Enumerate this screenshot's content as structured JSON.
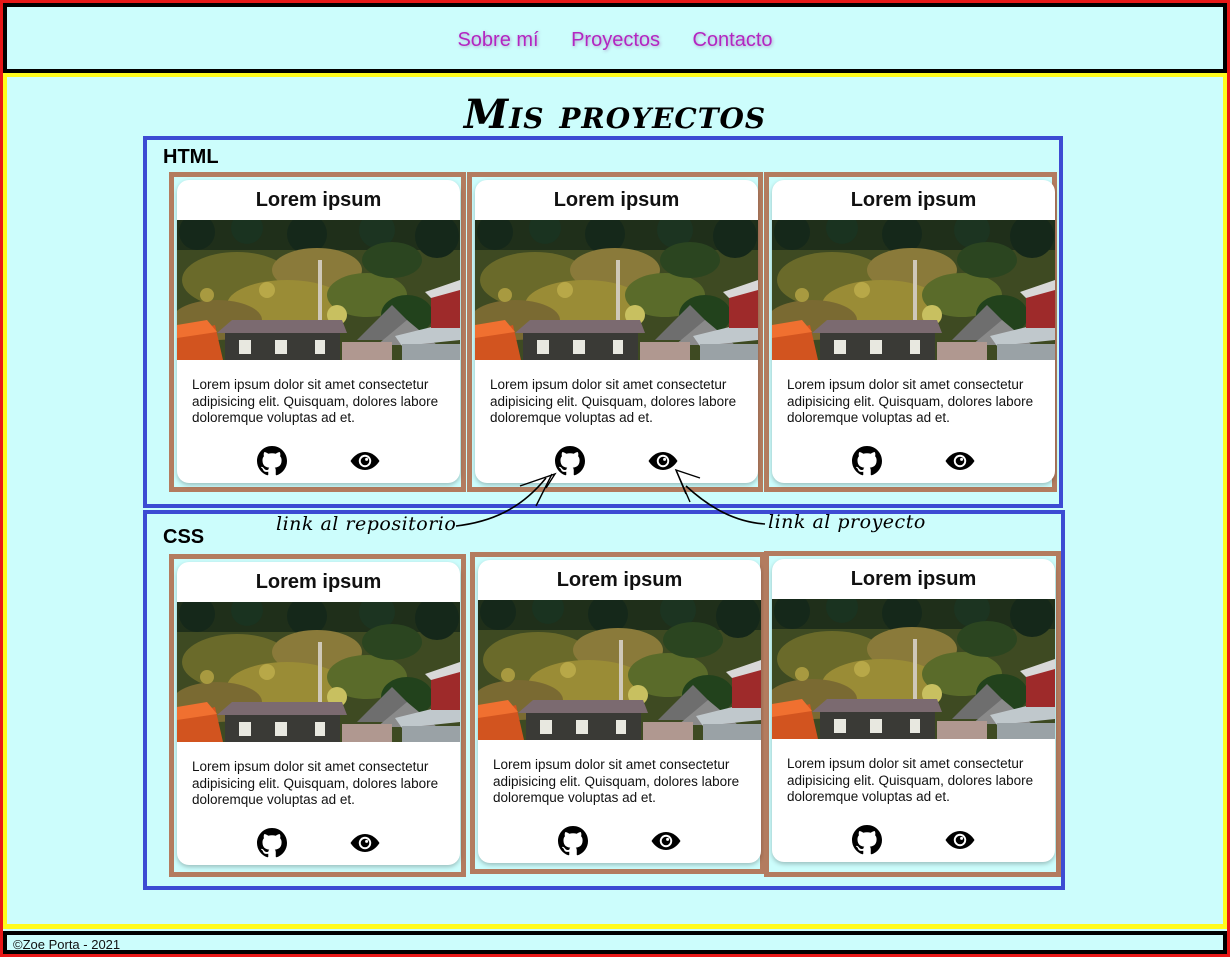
{
  "nav": {
    "items": [
      {
        "label": "Sobre mí"
      },
      {
        "label": "Proyectos"
      },
      {
        "label": "Contacto"
      }
    ]
  },
  "main": {
    "title": "Mis proyectos",
    "groups": [
      {
        "label": "HTML",
        "cards": [
          {
            "title": "Lorem ipsum",
            "text": "Lorem ipsum dolor sit amet consectetur adipisicing elit. Quisquam, dolores labore doloremque voluptas ad et.",
            "repo_icon": "github-icon",
            "project_icon": "eye-icon"
          },
          {
            "title": "Lorem ipsum",
            "text": "Lorem ipsum dolor sit amet consectetur adipisicing elit. Quisquam, dolores labore doloremque voluptas ad et.",
            "repo_icon": "github-icon",
            "project_icon": "eye-icon"
          },
          {
            "title": "Lorem ipsum",
            "text": "Lorem ipsum dolor sit amet consectetur adipisicing elit. Quisquam, dolores labore doloremque voluptas ad et.",
            "repo_icon": "github-icon",
            "project_icon": "eye-icon"
          }
        ]
      },
      {
        "label": "CSS",
        "cards": [
          {
            "title": "Lorem ipsum",
            "text": "Lorem ipsum dolor sit amet consectetur adipisicing elit. Quisquam, dolores labore doloremque voluptas ad et.",
            "repo_icon": "github-icon",
            "project_icon": "eye-icon"
          },
          {
            "title": "Lorem ipsum",
            "text": "Lorem ipsum dolor sit amet consectetur adipisicing elit. Quisquam, dolores labore doloremque voluptas ad et.",
            "repo_icon": "github-icon",
            "project_icon": "eye-icon"
          },
          {
            "title": "Lorem ipsum",
            "text": "Lorem ipsum dolor sit amet consectetur adipisicing elit. Quisquam, dolores labore doloremque voluptas ad et.",
            "repo_icon": "github-icon",
            "project_icon": "eye-icon"
          }
        ]
      }
    ]
  },
  "annotations": {
    "repo": "link al repositorio",
    "project": "link al proyecto"
  },
  "footer": {
    "text": "©Zoe Porta - 2021"
  },
  "colors": {
    "background": "#ccfdfc",
    "nav_link": "#b326c2",
    "outer_border": "#e81818",
    "main_border": "#fffb1e",
    "group_border": "#3d4bd3",
    "card_frame": "#b37c5f"
  }
}
